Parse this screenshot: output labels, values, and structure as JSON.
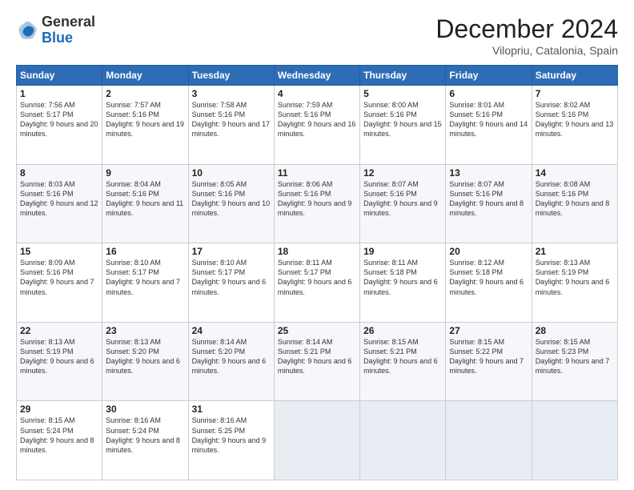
{
  "header": {
    "logo_general": "General",
    "logo_blue": "Blue",
    "month_title": "December 2024",
    "location": "Vilopriu, Catalonia, Spain"
  },
  "weekdays": [
    "Sunday",
    "Monday",
    "Tuesday",
    "Wednesday",
    "Thursday",
    "Friday",
    "Saturday"
  ],
  "weeks": [
    [
      {
        "day": "1",
        "sunrise": "7:56 AM",
        "sunset": "5:17 PM",
        "daylight": "9 hours and 20 minutes."
      },
      {
        "day": "2",
        "sunrise": "7:57 AM",
        "sunset": "5:16 PM",
        "daylight": "9 hours and 19 minutes."
      },
      {
        "day": "3",
        "sunrise": "7:58 AM",
        "sunset": "5:16 PM",
        "daylight": "9 hours and 17 minutes."
      },
      {
        "day": "4",
        "sunrise": "7:59 AM",
        "sunset": "5:16 PM",
        "daylight": "9 hours and 16 minutes."
      },
      {
        "day": "5",
        "sunrise": "8:00 AM",
        "sunset": "5:16 PM",
        "daylight": "9 hours and 15 minutes."
      },
      {
        "day": "6",
        "sunrise": "8:01 AM",
        "sunset": "5:16 PM",
        "daylight": "9 hours and 14 minutes."
      },
      {
        "day": "7",
        "sunrise": "8:02 AM",
        "sunset": "5:16 PM",
        "daylight": "9 hours and 13 minutes."
      }
    ],
    [
      {
        "day": "8",
        "sunrise": "8:03 AM",
        "sunset": "5:16 PM",
        "daylight": "9 hours and 12 minutes."
      },
      {
        "day": "9",
        "sunrise": "8:04 AM",
        "sunset": "5:16 PM",
        "daylight": "9 hours and 11 minutes."
      },
      {
        "day": "10",
        "sunrise": "8:05 AM",
        "sunset": "5:16 PM",
        "daylight": "9 hours and 10 minutes."
      },
      {
        "day": "11",
        "sunrise": "8:06 AM",
        "sunset": "5:16 PM",
        "daylight": "9 hours and 9 minutes."
      },
      {
        "day": "12",
        "sunrise": "8:07 AM",
        "sunset": "5:16 PM",
        "daylight": "9 hours and 9 minutes."
      },
      {
        "day": "13",
        "sunrise": "8:07 AM",
        "sunset": "5:16 PM",
        "daylight": "9 hours and 8 minutes."
      },
      {
        "day": "14",
        "sunrise": "8:08 AM",
        "sunset": "5:16 PM",
        "daylight": "9 hours and 8 minutes."
      }
    ],
    [
      {
        "day": "15",
        "sunrise": "8:09 AM",
        "sunset": "5:16 PM",
        "daylight": "9 hours and 7 minutes."
      },
      {
        "day": "16",
        "sunrise": "8:10 AM",
        "sunset": "5:17 PM",
        "daylight": "9 hours and 7 minutes."
      },
      {
        "day": "17",
        "sunrise": "8:10 AM",
        "sunset": "5:17 PM",
        "daylight": "9 hours and 6 minutes."
      },
      {
        "day": "18",
        "sunrise": "8:11 AM",
        "sunset": "5:17 PM",
        "daylight": "9 hours and 6 minutes."
      },
      {
        "day": "19",
        "sunrise": "8:11 AM",
        "sunset": "5:18 PM",
        "daylight": "9 hours and 6 minutes."
      },
      {
        "day": "20",
        "sunrise": "8:12 AM",
        "sunset": "5:18 PM",
        "daylight": "9 hours and 6 minutes."
      },
      {
        "day": "21",
        "sunrise": "8:13 AM",
        "sunset": "5:19 PM",
        "daylight": "9 hours and 6 minutes."
      }
    ],
    [
      {
        "day": "22",
        "sunrise": "8:13 AM",
        "sunset": "5:19 PM",
        "daylight": "9 hours and 6 minutes."
      },
      {
        "day": "23",
        "sunrise": "8:13 AM",
        "sunset": "5:20 PM",
        "daylight": "9 hours and 6 minutes."
      },
      {
        "day": "24",
        "sunrise": "8:14 AM",
        "sunset": "5:20 PM",
        "daylight": "9 hours and 6 minutes."
      },
      {
        "day": "25",
        "sunrise": "8:14 AM",
        "sunset": "5:21 PM",
        "daylight": "9 hours and 6 minutes."
      },
      {
        "day": "26",
        "sunrise": "8:15 AM",
        "sunset": "5:21 PM",
        "daylight": "9 hours and 6 minutes."
      },
      {
        "day": "27",
        "sunrise": "8:15 AM",
        "sunset": "5:22 PM",
        "daylight": "9 hours and 7 minutes."
      },
      {
        "day": "28",
        "sunrise": "8:15 AM",
        "sunset": "5:23 PM",
        "daylight": "9 hours and 7 minutes."
      }
    ],
    [
      {
        "day": "29",
        "sunrise": "8:15 AM",
        "sunset": "5:24 PM",
        "daylight": "9 hours and 8 minutes."
      },
      {
        "day": "30",
        "sunrise": "8:16 AM",
        "sunset": "5:24 PM",
        "daylight": "9 hours and 8 minutes."
      },
      {
        "day": "31",
        "sunrise": "8:16 AM",
        "sunset": "5:25 PM",
        "daylight": "9 hours and 9 minutes."
      },
      null,
      null,
      null,
      null
    ]
  ]
}
